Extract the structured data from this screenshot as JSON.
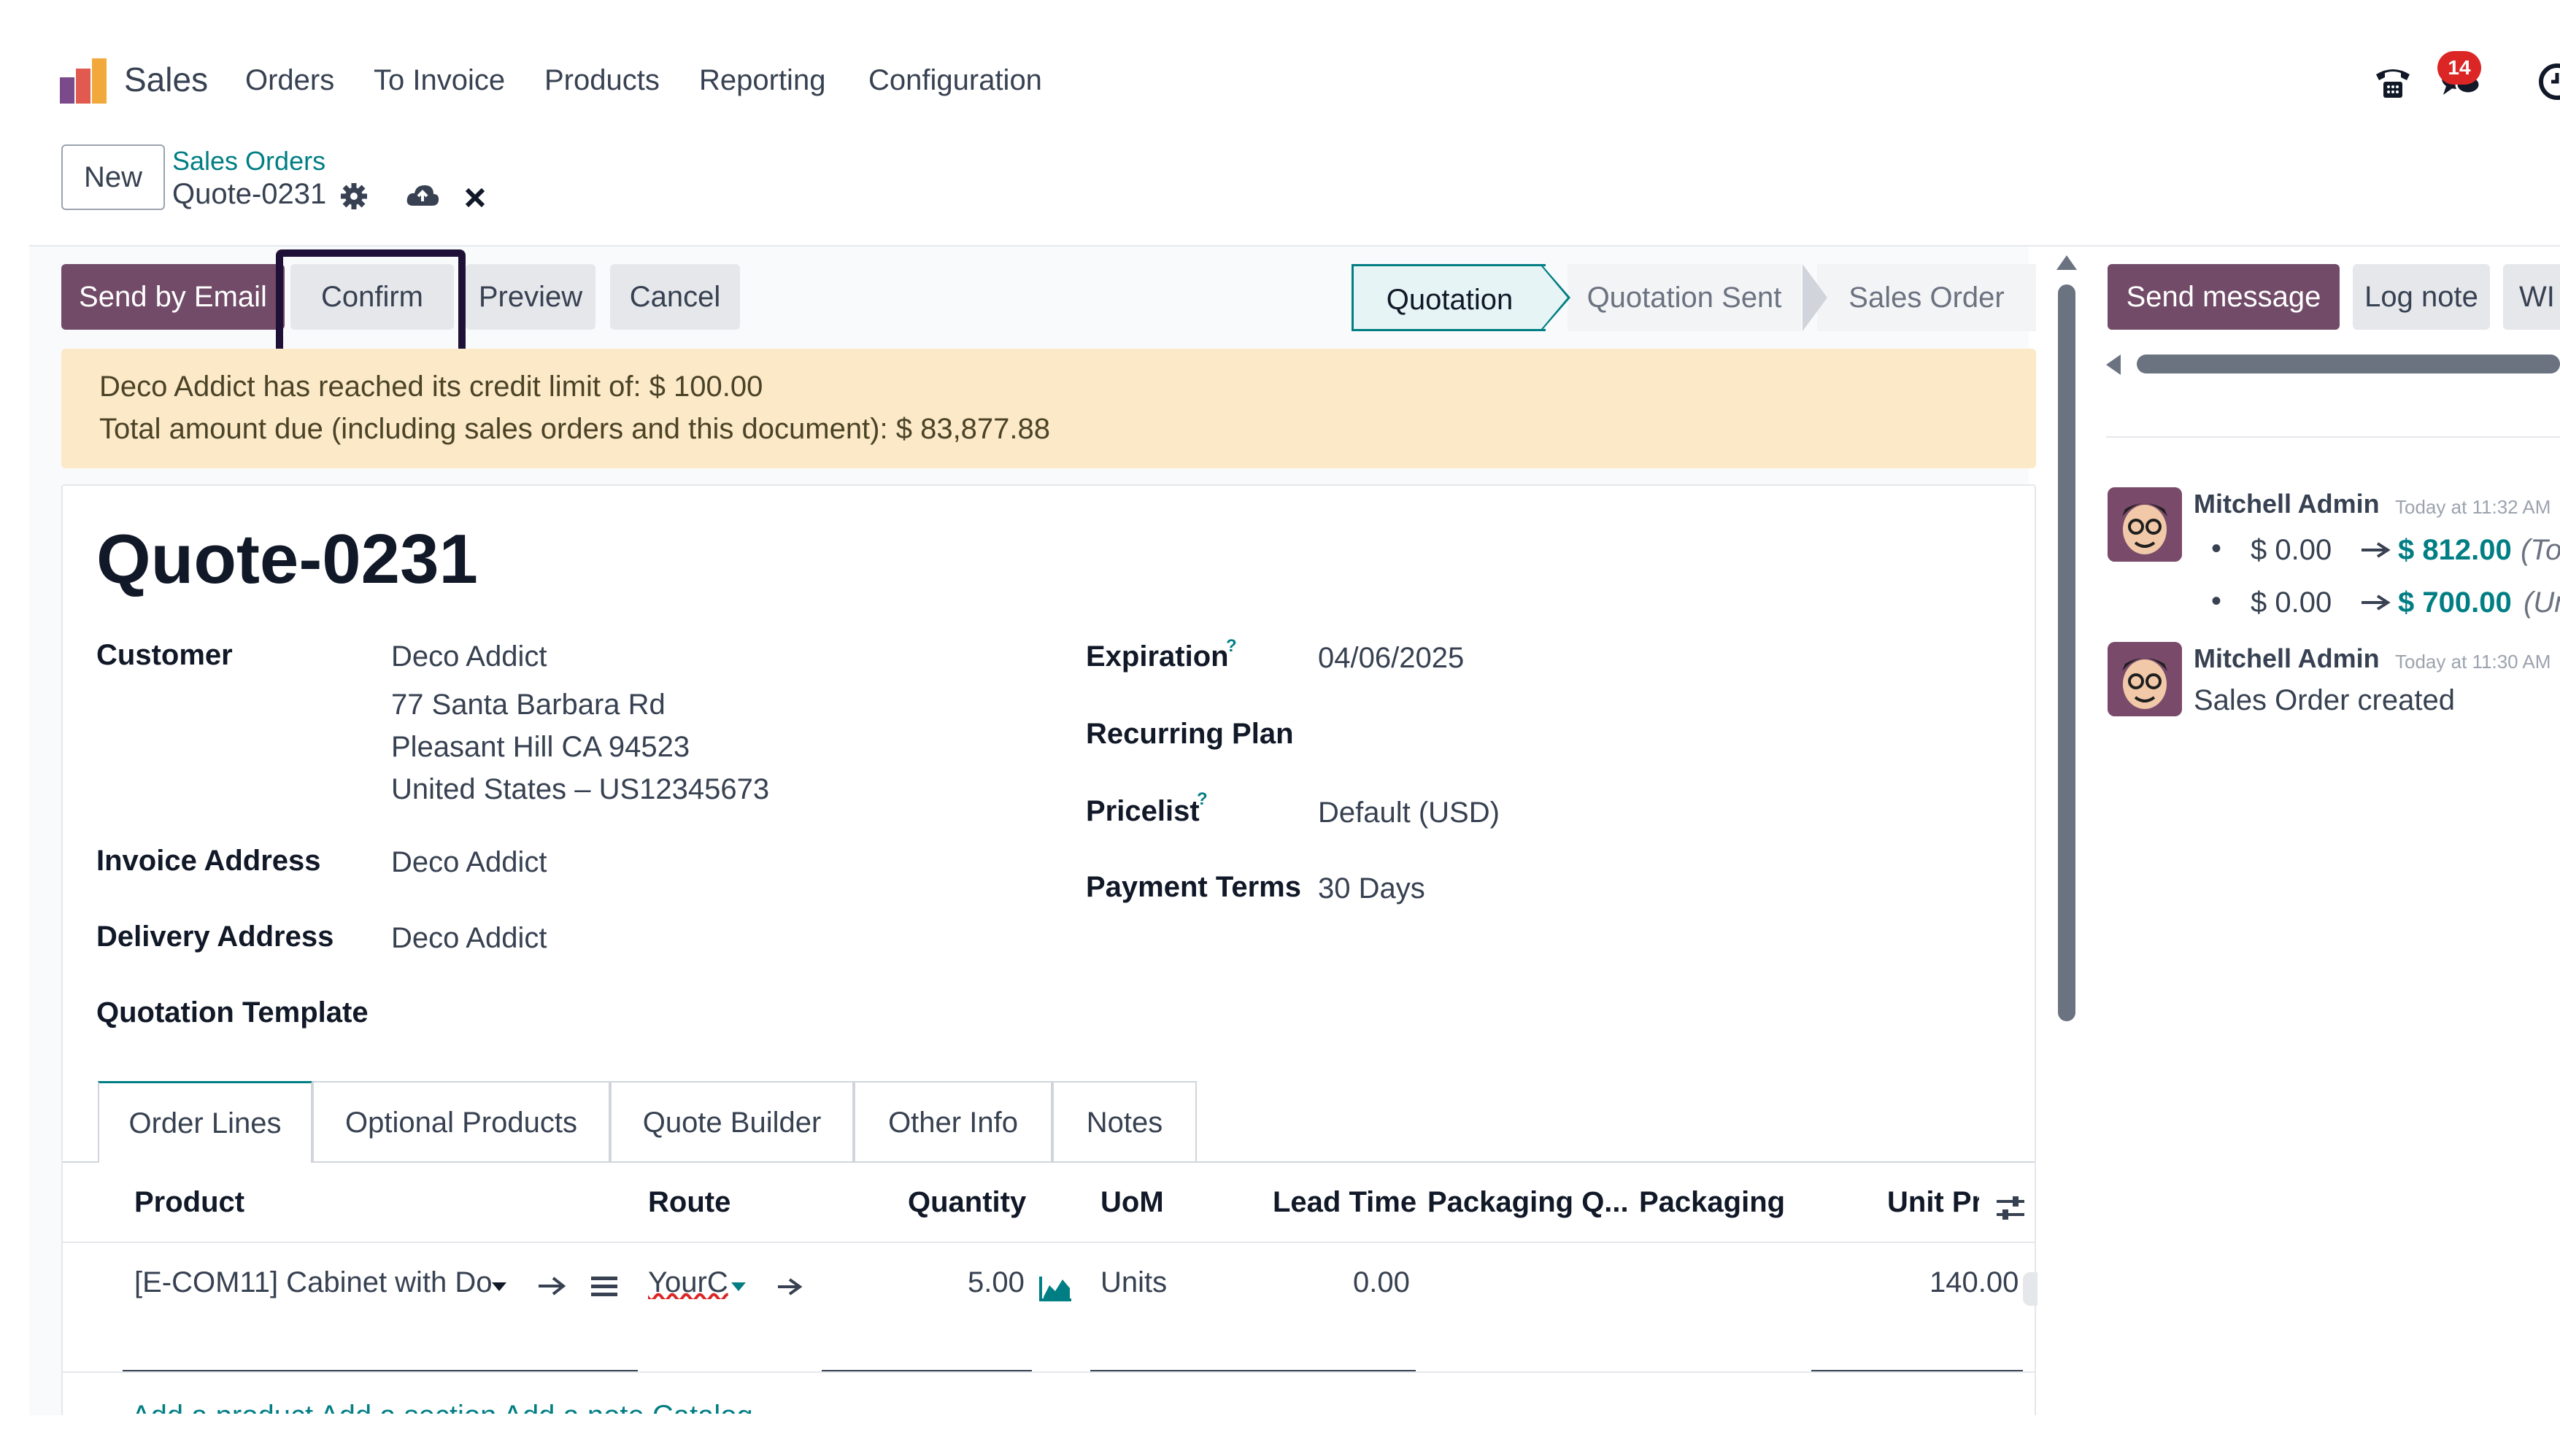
{
  "app": {
    "name": "Sales",
    "menu": [
      "Orders",
      "To Invoice",
      "Products",
      "Reporting",
      "Configuration"
    ],
    "notification_count": "14"
  },
  "breadcrumb": {
    "new_label": "New",
    "parent": "Sales Orders",
    "current": "Quote-0231"
  },
  "actions": {
    "send_email": "Send by Email",
    "confirm": "Confirm",
    "preview": "Preview",
    "cancel": "Cancel"
  },
  "status": {
    "stages": [
      "Quotation",
      "Quotation Sent",
      "Sales Order"
    ],
    "active": "Quotation"
  },
  "alert": {
    "line1": "Deco Addict has reached its credit limit of: $ 100.00",
    "line2": "Total amount due (including sales orders and this document): $ 83,877.88"
  },
  "form": {
    "title": "Quote-0231",
    "customer_label": "Customer",
    "customer_name": "Deco Addict",
    "customer_addr1": "77 Santa Barbara Rd",
    "customer_addr2": "Pleasant Hill CA 94523",
    "customer_addr3": "United States – US12345673",
    "invoice_label": "Invoice Address",
    "invoice_value": "Deco Addict",
    "delivery_label": "Delivery Address",
    "delivery_value": "Deco Addict",
    "template_label": "Quotation Template",
    "expiration_label": "Expiration",
    "expiration_value": "04/06/2025",
    "recurring_label": "Recurring Plan",
    "pricelist_label": "Pricelist",
    "pricelist_value": "Default (USD)",
    "payment_label": "Payment Terms",
    "payment_value": "30 Days",
    "help_mark": "?"
  },
  "tabs": [
    "Order Lines",
    "Optional Products",
    "Quote Builder",
    "Other Info",
    "Notes"
  ],
  "table": {
    "headers": [
      "Product",
      "Route",
      "Quantity",
      "UoM",
      "Lead Time",
      "Packaging Q...",
      "Packaging",
      "Unit Pri"
    ],
    "row": {
      "product": "[E-COM11] Cabinet with Do",
      "route": "YourC",
      "quantity": "5.00",
      "uom": "Units",
      "lead_time": "0.00",
      "unit_price": "140.00"
    },
    "add_links": "Add a product   Add a section   Add a note   Catalog"
  },
  "chatter": {
    "send_message": "Send message",
    "log_note": "Log note",
    "third": "WI",
    "messages": [
      {
        "author": "Mitchell Admin",
        "time": "Today at 11:32 AM",
        "changes": [
          {
            "old": "$ 0.00",
            "new": "$ 812.00",
            "field": "(Tota"
          },
          {
            "old": "$ 0.00",
            "new": "$ 700.00",
            "field": "(Unt"
          }
        ]
      },
      {
        "author": "Mitchell Admin",
        "time": "Today at 11:30 AM",
        "body": "Sales Order created"
      }
    ]
  },
  "colors": {
    "brand": "#714b67",
    "accent": "#017e84",
    "alert_bg": "#fbe9c7",
    "badge": "#dc2626",
    "highlight_outline": "#1e1036"
  }
}
